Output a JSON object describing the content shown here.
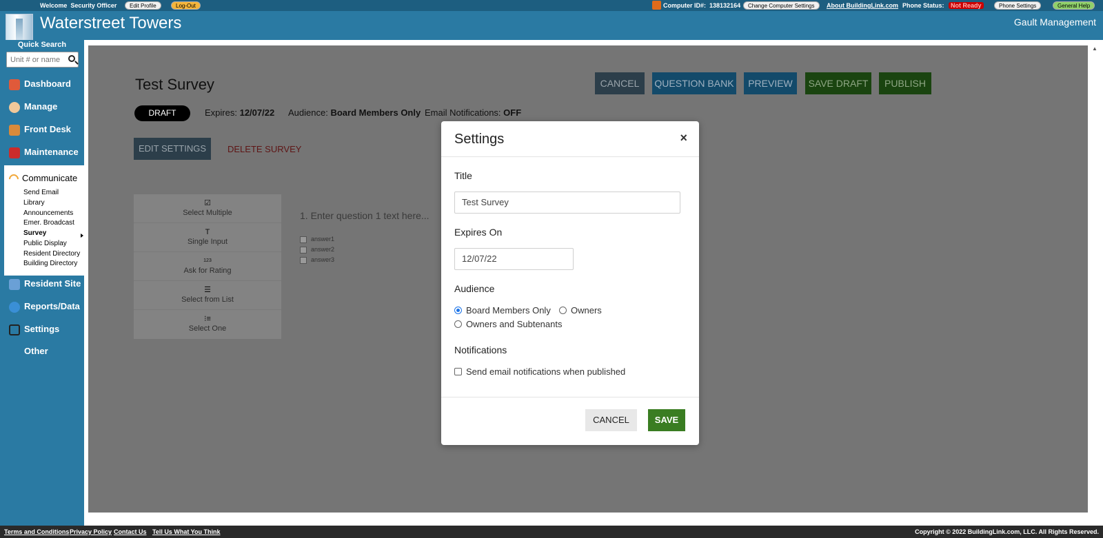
{
  "topbar": {
    "welcome": "Welcome",
    "user": "Security Officer",
    "edit_profile": "Edit Profile",
    "logout": "Log-Out",
    "computer_id_label": "Computer ID#:",
    "computer_id": "138132164",
    "change_settings": "Change Computer Settings",
    "about": "About BuildingLink.com",
    "phone_status_label": "Phone Status:",
    "phone_status": "Not Ready",
    "phone_settings": "Phone Settings",
    "general_help": "General Help"
  },
  "header": {
    "site_title": "Waterstreet Towers",
    "management": "Gault Management"
  },
  "sidebar": {
    "quick_search_label": "Quick Search",
    "quick_search_placeholder": "Unit # or name",
    "items": [
      {
        "label": "Dashboard",
        "color": "#e05a3a"
      },
      {
        "label": "Manage",
        "color": "#f0c89a"
      },
      {
        "label": "Front Desk",
        "color": "#d98a3a"
      },
      {
        "label": "Maintenance",
        "color": "#cc2b2b"
      }
    ],
    "communicate": {
      "label": "Communicate",
      "subitems": [
        "Send Email",
        "Library",
        "Announcements",
        "Emer. Broadcast",
        "Survey",
        "Public Display",
        "Resident Directory",
        "Building Directory"
      ],
      "active": "Survey"
    },
    "items2": [
      {
        "label": "Resident Site",
        "color": "#6aa0d6"
      },
      {
        "label": "Reports/Data",
        "color": "#3a8fd6"
      },
      {
        "label": "Settings",
        "color": "#333333"
      },
      {
        "label": "Other",
        "color": ""
      }
    ]
  },
  "survey": {
    "title": "Test Survey",
    "status": "DRAFT",
    "expires_label": "Expires:",
    "expires": "12/07/22",
    "audience_label": "Audience:",
    "audience": "Board Members Only",
    "email_label": "Email Notifications:",
    "email": "OFF",
    "buttons": {
      "cancel": "CANCEL",
      "question_bank": "QUESTION BANK",
      "preview": "PREVIEW",
      "save_draft": "SAVE DRAFT",
      "publish": "PUBLISH"
    },
    "edit_settings": "EDIT SETTINGS",
    "delete_survey": "DELETE SURVEY",
    "question_types": [
      {
        "label": "Select Multiple",
        "icon": "checkbox-icon"
      },
      {
        "label": "Single Input",
        "icon": "text-icon"
      },
      {
        "label": "Ask for Rating",
        "icon": "rating-icon"
      },
      {
        "label": "Select from List",
        "icon": "list-icon"
      },
      {
        "label": "Select One",
        "icon": "radio-list-icon"
      }
    ],
    "question": "1. Enter question 1 text here...",
    "answers": [
      "answer1",
      "answer2",
      "answer3"
    ]
  },
  "modal": {
    "title": "Settings",
    "close": "×",
    "title_label": "Title",
    "title_value": "Test Survey",
    "expires_label": "Expires On",
    "expires_value": "12/07/22",
    "audience_label": "Audience",
    "audience_options": [
      "Board Members Only",
      "Owners",
      "Owners and Subtenants"
    ],
    "audience_selected": "Board Members Only",
    "notifications_label": "Notifications",
    "notify_checkbox": "Send email notifications when published",
    "notify_checked": false,
    "cancel": "CANCEL",
    "save": "SAVE"
  },
  "footer": {
    "terms": "Terms and Conditions",
    "privacy": "Privacy Policy",
    "contact": "Contact Us",
    "tell": "Tell Us What You Think",
    "copyright": "Copyright © 2022 BuildingLink.com, LLC.   All Rights Reserved."
  }
}
